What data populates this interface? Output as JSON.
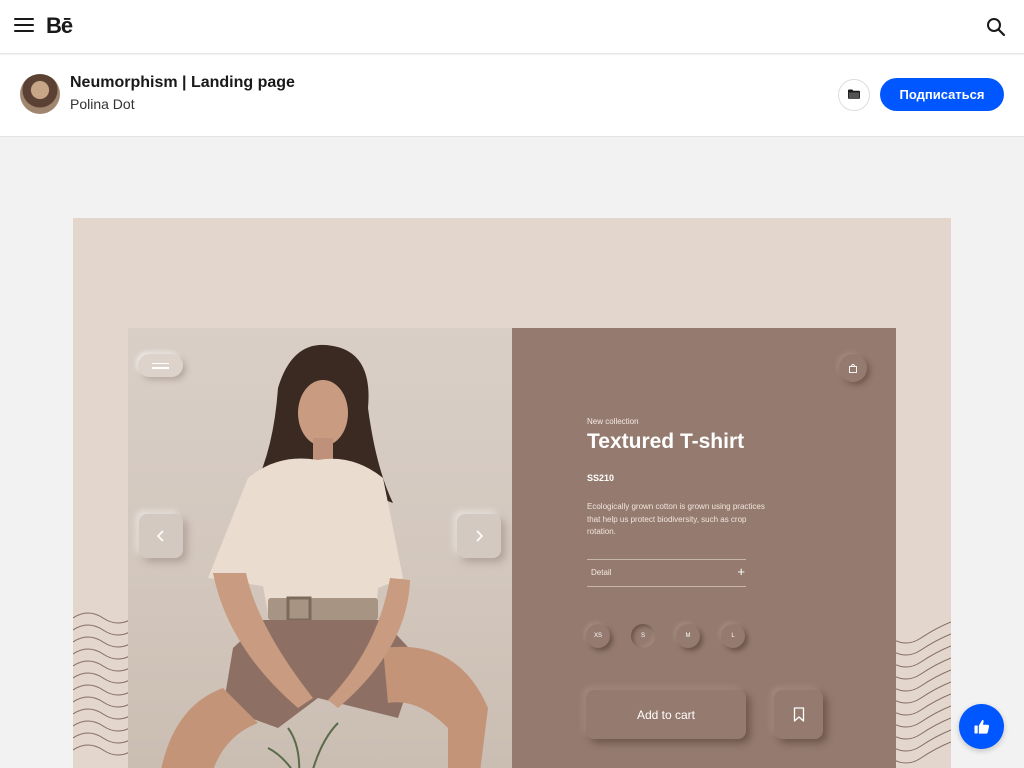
{
  "nav": {
    "logo": "Bē",
    "menu_icon": "hamburger-menu-icon",
    "search_icon": "search-icon"
  },
  "project": {
    "title": "Neumorphism | Landing page",
    "author": "Polina Dot",
    "folder_icon": "folder-icon",
    "follow_label": "Подписаться",
    "accent_color": "#0057ff"
  },
  "artwork": {
    "eyebrow": "New collection",
    "product_title": "Textured T-shirt",
    "price": "SS210",
    "description": "Ecologically grown cotton is grown using practices that help us protect biodiversity, such as crop rotation.",
    "detail_label": "Detail",
    "detail_plus": "+",
    "sizes": [
      "XS",
      "S",
      "M",
      "L"
    ],
    "selected_size": "S",
    "cart_label": "Add to cart",
    "panel_color": "#957b6f",
    "backdrop_color": "#e3d6cc"
  },
  "appreciate_icon": "thumbs-up-icon"
}
